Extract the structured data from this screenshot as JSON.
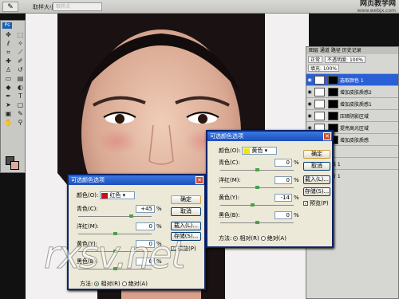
{
  "optionsBar": {
    "tool_icon": "eyedropper-icon",
    "sample_size_label": "取样大小:",
    "sample_size_value": "取样点"
  },
  "watermark": {
    "site_cn": "网页教学网",
    "site_url": "www.webjx.com",
    "canvas_mark": "rxsv.net"
  },
  "toolbox": {
    "logo": "Ps",
    "foreground_color": "#4b4b4b",
    "background_color": "#dcaaa0"
  },
  "layersPanel": {
    "tabs": "图层 通道 路径 历史记录",
    "blend_mode": "正常",
    "opacity_label": "不透明度: 100%",
    "fill_label": "填充: 100%",
    "layers": [
      {
        "name": "选取颜色 1",
        "selected": true
      },
      {
        "name": "增加皮肤质感2",
        "selected": false
      },
      {
        "name": "增加皮肤质感1",
        "selected": false
      },
      {
        "name": "压暗阴影区域",
        "selected": false
      },
      {
        "name": "提亮高光区域",
        "selected": false
      },
      {
        "name": "增加皮肤质感",
        "selected": false
      },
      {
        "name": "本",
        "selected": false
      },
      {
        "name": "曲线 1",
        "selected": false
      },
      {
        "name": "色阶 1",
        "selected": false
      }
    ]
  },
  "dialogLeft": {
    "title": "可选颜色选项",
    "color_label": "颜色(O):",
    "color_value": "红色",
    "color_swatch": "#d01010",
    "sliders": [
      {
        "label": "青色(C):",
        "value": "+45",
        "unit": "%",
        "position": 0.72
      },
      {
        "label": "洋红(M):",
        "value": "0",
        "unit": "%",
        "position": 0.5
      },
      {
        "label": "黄色(Y):",
        "value": "0",
        "unit": "%",
        "position": 0.5
      },
      {
        "label": "黑色(B):",
        "value": "0",
        "unit": "%",
        "position": 0.5
      }
    ],
    "ok": "确定",
    "cancel": "取消",
    "load": "载入(L)...",
    "save": "存储(S)...",
    "preview": "预览(P)",
    "method_label": "方法:",
    "relative": "相对(R)",
    "absolute": "绝对(A)"
  },
  "dialogRight": {
    "title": "可选颜色选项",
    "color_label": "颜色(O):",
    "color_value": "黄色",
    "color_swatch": "#f2e414",
    "sliders": [
      {
        "label": "青色(C):",
        "value": "0",
        "unit": "%",
        "position": 0.5
      },
      {
        "label": "洋红(M):",
        "value": "0",
        "unit": "%",
        "position": 0.5
      },
      {
        "label": "黄色(Y):",
        "value": "-14",
        "unit": "%",
        "position": 0.43
      },
      {
        "label": "黑色(B):",
        "value": "0",
        "unit": "%",
        "position": 0.5
      }
    ],
    "ok": "确定",
    "cancel": "取消",
    "load": "载入(L)...",
    "save": "存储(S)...",
    "preview": "预览(P)",
    "method_label": "方法:",
    "relative": "相对(R)",
    "absolute": "绝对(A)"
  }
}
